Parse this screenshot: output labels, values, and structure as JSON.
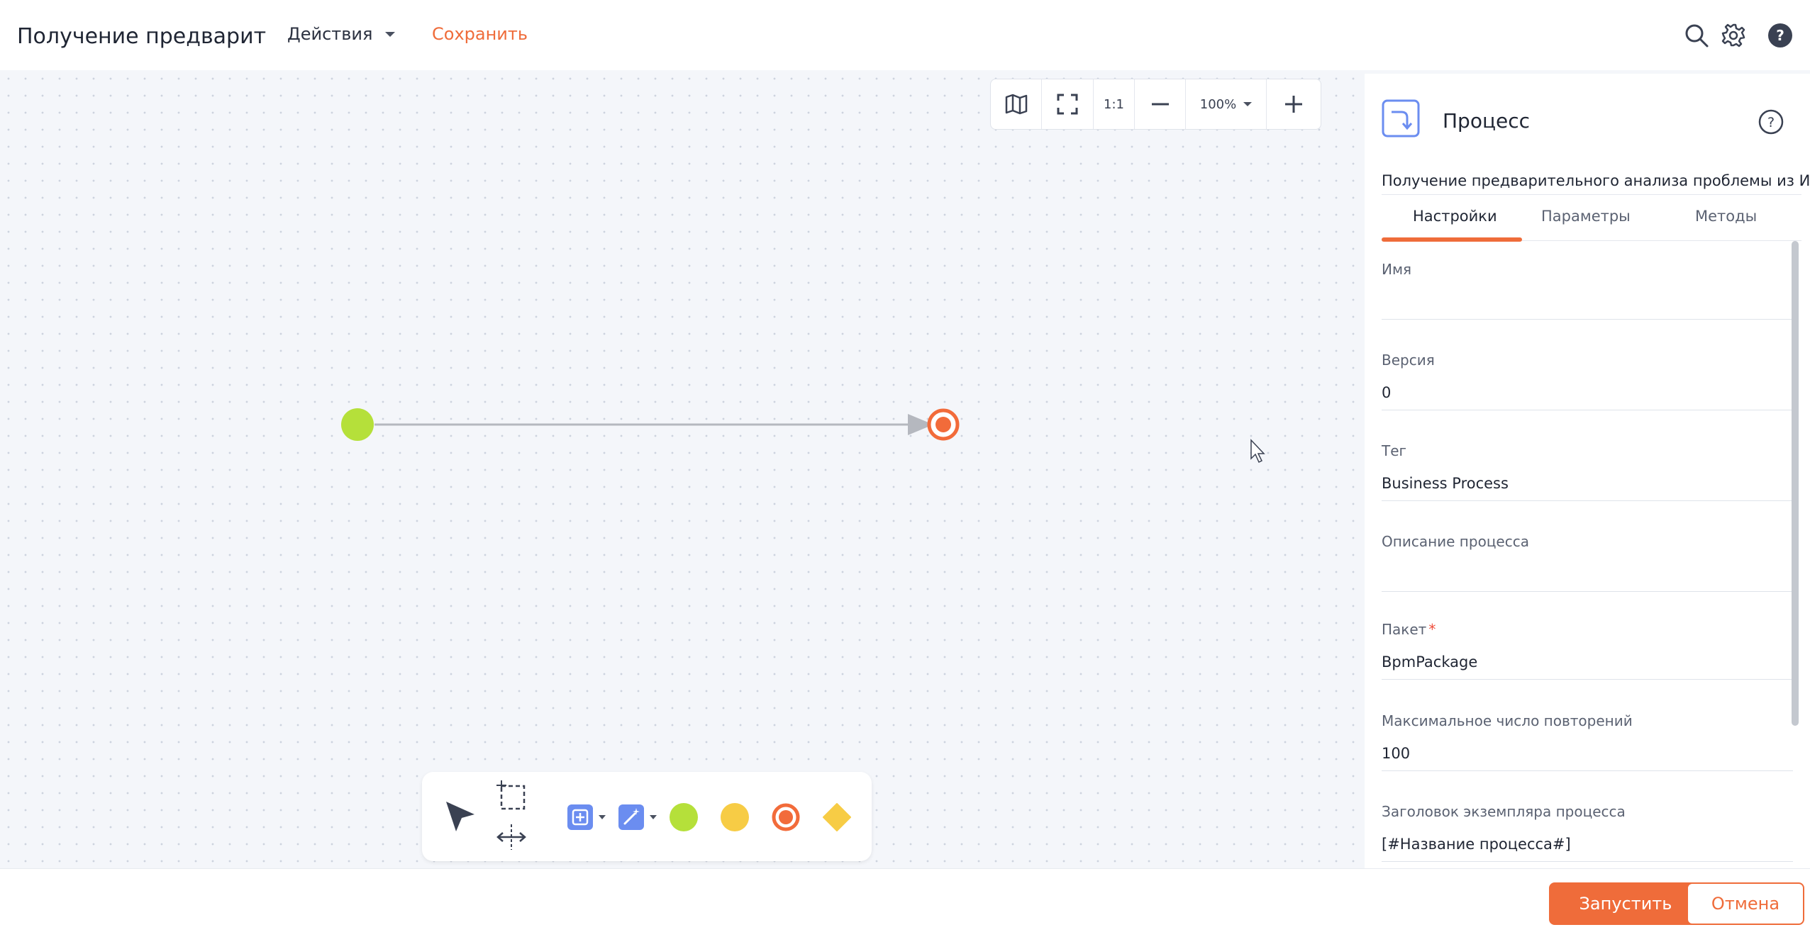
{
  "header": {
    "title": "Получение предварит",
    "actions_label": "Действия",
    "save_label": "Сохранить"
  },
  "zoom": {
    "one_to_one": "1:1",
    "level": "100%"
  },
  "panel": {
    "title": "Процесс",
    "description": "Получение предварительного анализа проблемы из ИИ",
    "tabs": [
      "Настройки",
      "Параметры",
      "Методы"
    ],
    "fields": [
      {
        "label": "Имя",
        "value": "",
        "required": false
      },
      {
        "label": "Версия",
        "value": "0",
        "required": false
      },
      {
        "label": "Тег",
        "value": "Business Process",
        "required": false
      },
      {
        "label": "Описание процесса",
        "value": "",
        "required": false
      },
      {
        "label": "Пакет",
        "value": "BpmPackage",
        "required": true
      },
      {
        "label": "Максимальное число повторений",
        "value": "100",
        "required": false
      },
      {
        "label": "Заголовок экземпляра процесса",
        "value": "[#Название процесса#]",
        "required": false
      }
    ]
  },
  "footer": {
    "run_label": "Запустить",
    "cancel_label": "Отмена"
  },
  "colors": {
    "accent": "#ef6c3a",
    "start_event": "#b5e03a",
    "intermediate_event": "#f7cc45",
    "end_event": "#f26b3a",
    "gateway": "#f7cc45",
    "task_icon": "#6b8df0"
  },
  "icons": [
    "search-icon",
    "gear-icon",
    "help-icon",
    "map-icon",
    "fullscreen-icon",
    "minus-icon",
    "plus-icon",
    "process-icon",
    "cursor-icon",
    "lasso-icon",
    "space-tool-icon",
    "task-icon",
    "magic-icon"
  ]
}
